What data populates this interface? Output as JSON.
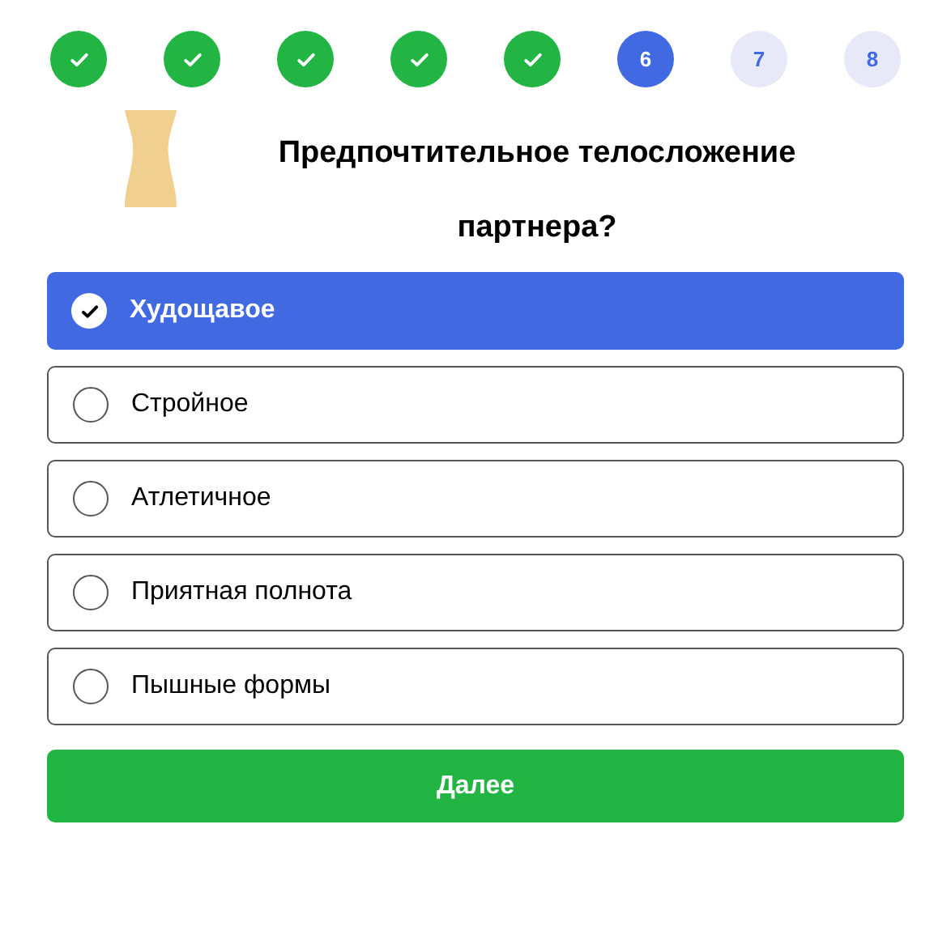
{
  "steps": [
    {
      "kind": "done"
    },
    {
      "kind": "done"
    },
    {
      "kind": "done"
    },
    {
      "kind": "done"
    },
    {
      "kind": "done"
    },
    {
      "kind": "current",
      "label": "6"
    },
    {
      "kind": "pending",
      "label": "7"
    },
    {
      "kind": "pending",
      "label": "8"
    }
  ],
  "question": "Предпочтительное телосложение партнера?",
  "options": [
    {
      "label": "Худощавое",
      "selected": true
    },
    {
      "label": "Стройное",
      "selected": false
    },
    {
      "label": "Атлетичное",
      "selected": false
    },
    {
      "label": "Приятная полнота",
      "selected": false
    },
    {
      "label": "Пышные формы",
      "selected": false
    }
  ],
  "next_button": "Далее"
}
